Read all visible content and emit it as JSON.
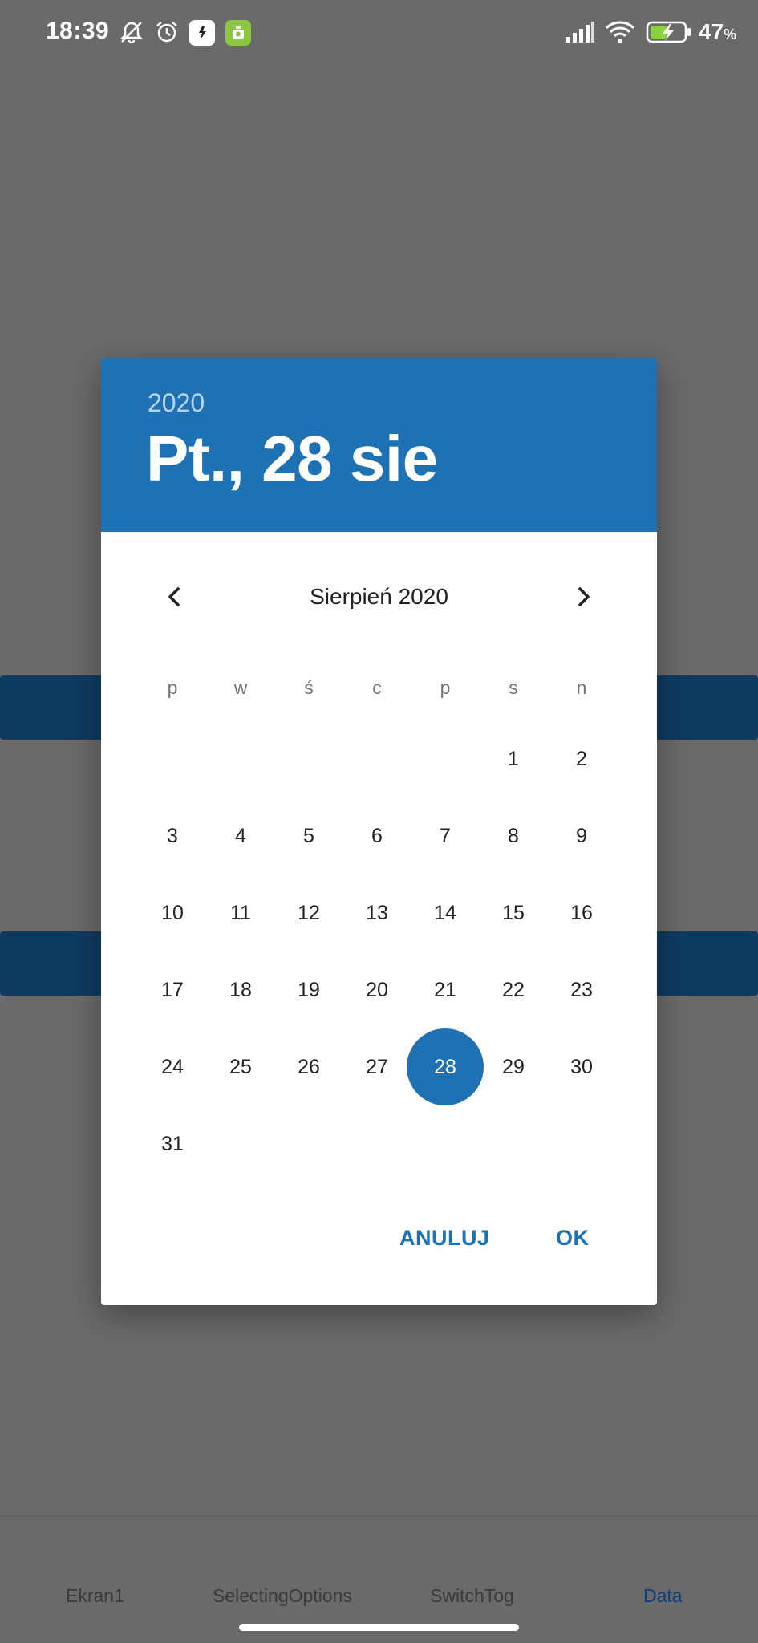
{
  "status_bar": {
    "time": "18:39",
    "battery_percent": "47",
    "battery_unit": "%",
    "icons": [
      "bell-off-icon",
      "alarm-icon",
      "app-icon-white",
      "app-icon-green",
      "signal-icon",
      "wifi-icon",
      "battery-charging-icon"
    ]
  },
  "dialog": {
    "year": "2020",
    "selected_date": "Pt., 28 sie",
    "month_label": "Sierpień 2020",
    "weekdays": [
      "p",
      "w",
      "ś",
      "c",
      "p",
      "s",
      "n"
    ],
    "days": [
      "1",
      "2",
      "3",
      "4",
      "5",
      "6",
      "7",
      "8",
      "9",
      "10",
      "11",
      "12",
      "13",
      "14",
      "15",
      "16",
      "17",
      "18",
      "19",
      "20",
      "21",
      "22",
      "23",
      "24",
      "25",
      "26",
      "27",
      "28",
      "29",
      "30",
      "31"
    ],
    "selected_day": "28",
    "cancel_label": "ANULUJ",
    "ok_label": "OK",
    "accent_color": "#1e71b2"
  },
  "bottom_nav": {
    "items": [
      "Ekran1",
      "SelectingOptions",
      "SwitchTog",
      "Data"
    ],
    "active": "Data"
  }
}
